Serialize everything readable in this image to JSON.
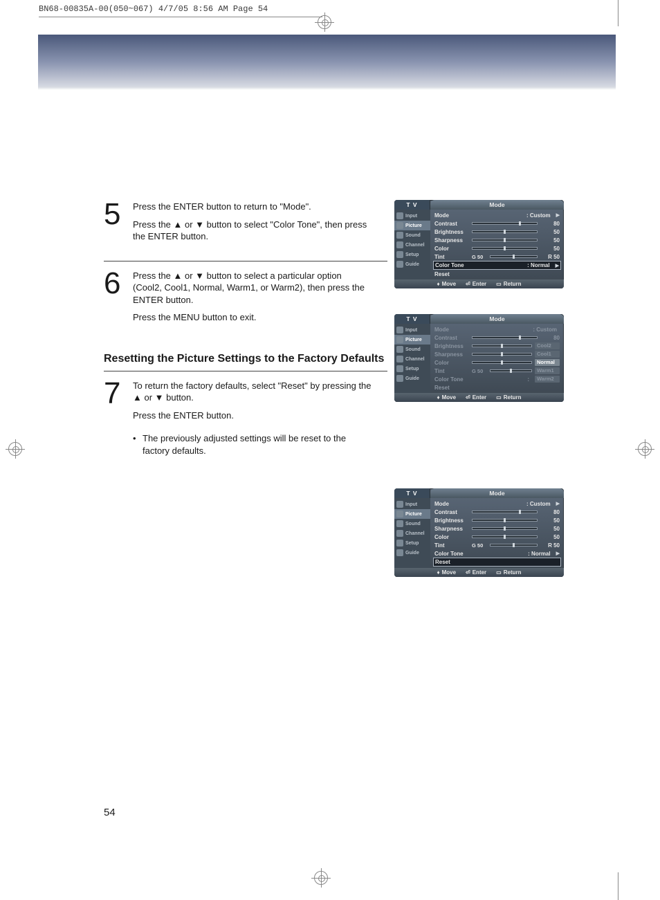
{
  "print_header": "BN68-00835A-00(050~067)  4/7/05  8:56 AM  Page 54",
  "page_number": "54",
  "section_heading": "Resetting the Picture Settings to the Factory Defaults",
  "steps": {
    "s5": {
      "num": "5",
      "l1": "Press the ENTER button to return to \"Mode\".",
      "l2": "Press the ▲ or ▼ button to select \"Color Tone\", then press the ENTER button."
    },
    "s6": {
      "num": "6",
      "l1": "Press the ▲ or ▼ button to select a particular option (Cool2, Cool1, Normal, Warm1, or Warm2), then press the ENTER button.",
      "l2": "Press the MENU button to exit."
    },
    "s7": {
      "num": "7",
      "l1": "To return the factory defaults, select \"Reset\" by pressing the ▲ or ▼ button.",
      "l2": "Press the ENTER button.",
      "bullet": "The previously adjusted settings will be reset to the factory defaults."
    }
  },
  "osd_common": {
    "tv": "T V",
    "title": "Mode",
    "sidebar": [
      "Input",
      "Picture",
      "Sound",
      "Channel",
      "Setup",
      "Guide"
    ],
    "footer": {
      "move": "Move",
      "enter": "Enter",
      "return": "Return"
    },
    "items": {
      "mode": "Mode",
      "contrast": "Contrast",
      "brightness": "Brightness",
      "sharpness": "Sharpness",
      "color": "Color",
      "tint": "Tint",
      "tint_l": "G 50",
      "tint_r": "R 50",
      "colortone": "Color Tone",
      "reset": "Reset"
    },
    "mode_val": ": Custom",
    "ct_val": ": Normal",
    "v80": "80",
    "v50": "50"
  },
  "tone_options": [
    "Cool2",
    "Cool1",
    "Normal",
    "Warm1",
    "Warm2"
  ]
}
